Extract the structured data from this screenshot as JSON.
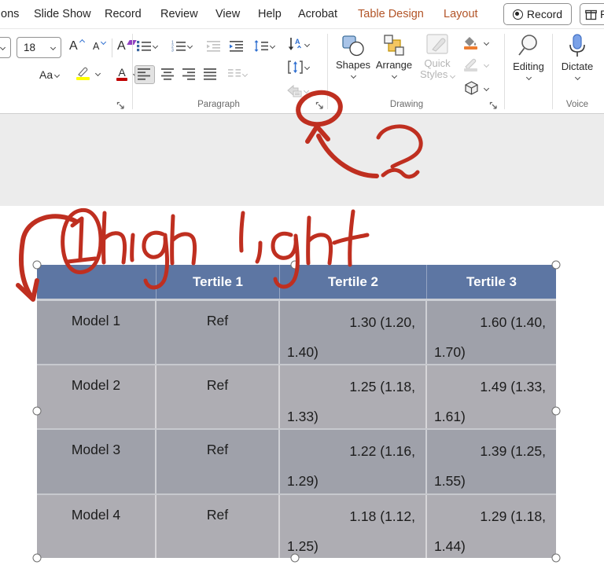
{
  "colors": {
    "ink_red": "#bf2f20",
    "contextual_tab_text": "#b25427",
    "table_header_bg": "#5d76a3",
    "table_header_text": "#ffffff",
    "table_row_dark": "#9fa1aa",
    "table_row_light": "#aeadb3",
    "highlight_yellow": "#ffff00",
    "font_color_red": "#c00000",
    "shape_fill_orange": "#ed7d31",
    "mic_blue": "#7ba2e8",
    "canvas_gray": "#ececec"
  },
  "menubar": {
    "items": [
      {
        "label": "ons"
      },
      {
        "label": "Slide Show"
      },
      {
        "label": "Record"
      },
      {
        "label": "Review"
      },
      {
        "label": "View"
      },
      {
        "label": "Help"
      },
      {
        "label": "Acrobat"
      },
      {
        "label": "Table Design"
      },
      {
        "label": "Layout"
      }
    ],
    "record_button_label": "Record",
    "present_button_label": "P"
  },
  "ribbon": {
    "font_group": {
      "font_size": "18",
      "grow_label": "A",
      "shrink_label": "A",
      "clear_label": "A",
      "change_case_label": "Aa",
      "color_label": "A"
    },
    "paragraph_group": {
      "label": "Paragraph"
    },
    "drawing_group": {
      "label": "Drawing",
      "shapes_label": "Shapes",
      "arrange_label": "Arrange",
      "quick_styles_line1": "Quick",
      "quick_styles_line2": "Styles"
    },
    "editing_group": {
      "editing_label": "Editing"
    },
    "voice_group": {
      "label": "Voice",
      "dictate_label": "Dictate"
    }
  },
  "table": {
    "headers": [
      "",
      "Tertile 1",
      "Tertile 2",
      "Tertile 3"
    ],
    "rows": [
      {
        "label": "Model 1",
        "t1": "Ref",
        "t2_line1": "1.30 (1.20,",
        "t2_line2": "1.40)",
        "t3_line1": "1.60 (1.40,",
        "t3_line2": "1.70)"
      },
      {
        "label": "Model 2",
        "t1": "Ref",
        "t2_line1": "1.25 (1.18,",
        "t2_line2": "1.33)",
        "t3_line1": "1.49 (1.33,",
        "t3_line2": "1.61)"
      },
      {
        "label": "Model 3",
        "t1": "Ref",
        "t2_line1": "1.22 (1.16,",
        "t2_line2": "1.29)",
        "t3_line1": "1.39 (1.25,",
        "t3_line2": "1.55)"
      },
      {
        "label": "Model 4",
        "t1": "Ref",
        "t2_line1": "1.18 (1.12,",
        "t2_line2": "1.25)",
        "t3_line1": "1.29 (1.18,",
        "t3_line2": "1.44)"
      }
    ]
  },
  "annotations": {
    "step1_number": "1",
    "step1_text": "highlight",
    "step2_number": "2"
  }
}
